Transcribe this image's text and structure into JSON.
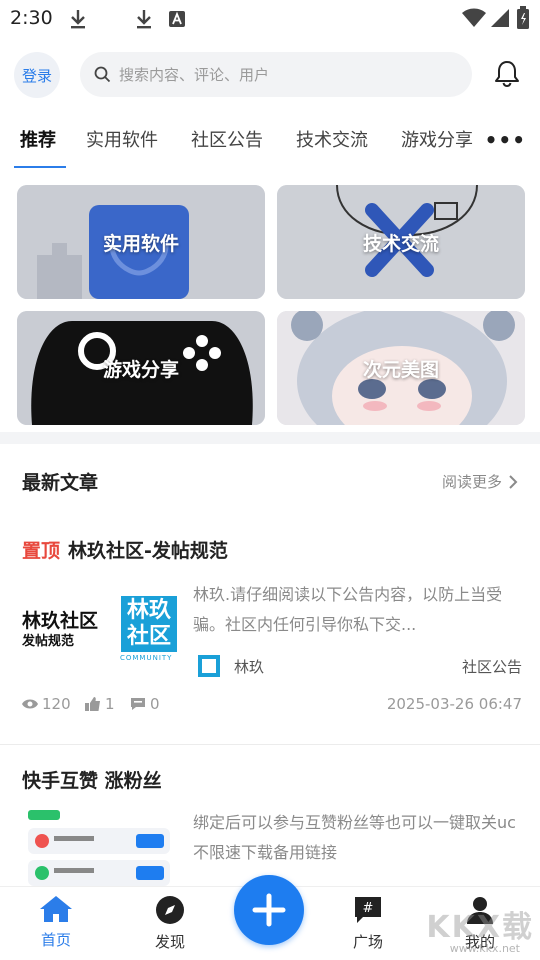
{
  "status_bar": {
    "time": "2:30"
  },
  "header": {
    "login_label": "登录",
    "search_placeholder": "搜索内容、评论、用户"
  },
  "tabs": [
    {
      "label": "推荐",
      "active": true
    },
    {
      "label": "实用软件"
    },
    {
      "label": "社区公告"
    },
    {
      "label": "技术交流"
    },
    {
      "label": "游戏分享"
    }
  ],
  "categories": [
    {
      "label": "实用软件"
    },
    {
      "label": "技术交流"
    },
    {
      "label": "游戏分享"
    },
    {
      "label": "次元美图"
    }
  ],
  "latest": {
    "title": "最新文章",
    "read_more": "阅读更多"
  },
  "articles": [
    {
      "pin_label": "置顶",
      "title": "林玖社区-发帖规范",
      "thumb_text_1": "林玖社区",
      "thumb_text_2": "发帖规范",
      "thumb_logo_1": "林玖",
      "thumb_logo_2": "社区",
      "thumb_logo_sub": "COMMUNITY",
      "excerpt": "林玖.请仔细阅读以下公告内容，以防上当受骗。社区内任何引导你私下交...",
      "author": "林玖",
      "category": "社区公告",
      "views": "120",
      "likes": "1",
      "comments": "0",
      "date": "2025-03-26 06:47"
    },
    {
      "title": "快手互赞 涨粉丝",
      "excerpt": "绑定后可以参与互赞粉丝等也可以一键取关uc不限速下载备用链接"
    }
  ],
  "bottom_nav": [
    {
      "label": "首页",
      "active": true
    },
    {
      "label": "发现"
    },
    {
      "label": "广场"
    },
    {
      "label": "我的"
    }
  ],
  "watermark": {
    "text": "KKX载",
    "sub": "www.kkx.net"
  },
  "colors": {
    "accent": "#2b7de9",
    "pin": "#e8483d",
    "fab": "#1e7df0"
  }
}
